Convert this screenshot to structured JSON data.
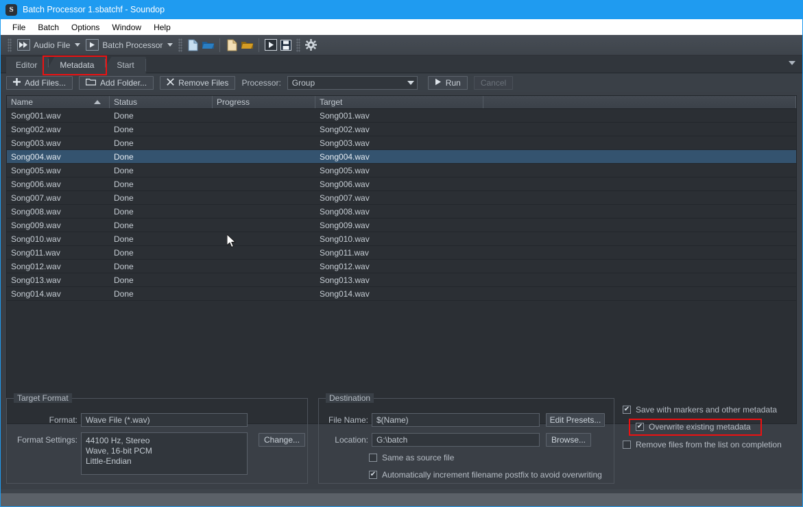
{
  "window": {
    "app_icon": "soundop-s-icon",
    "title": "Batch Processor 1.sbatchf - Soundop",
    "title_color": "#1f9bf0"
  },
  "menubar": {
    "items": [
      {
        "label": "File"
      },
      {
        "label": "Batch"
      },
      {
        "label": "Options"
      },
      {
        "label": "Window"
      },
      {
        "label": "Help"
      }
    ]
  },
  "toolbar": {
    "mode_combo": {
      "label": "Audio File",
      "icon": "fast-forward-icon"
    },
    "workspace_combo": {
      "label": "Batch Processor",
      "icon": "play-triangle-icon"
    },
    "icons": [
      {
        "name": "new-file-icon"
      },
      {
        "name": "open-file-icon"
      },
      {
        "name": "new-batch-icon"
      },
      {
        "name": "open-batch-icon"
      },
      {
        "name": "run-batch-icon"
      },
      {
        "name": "save-icon"
      },
      {
        "name": "settings-gear-icon"
      }
    ]
  },
  "tabs": {
    "items": [
      {
        "label": "Editor",
        "active": false
      },
      {
        "label": "Metadata",
        "active": true,
        "highlighted": true
      },
      {
        "label": "Start",
        "active": false
      }
    ],
    "overflow_icon": "chevron-down-icon"
  },
  "actionbar": {
    "add_files": {
      "label": "Add Files...",
      "icon": "plus-icon"
    },
    "add_folder": {
      "label": "Add Folder...",
      "icon": "folder-icon"
    },
    "remove_files": {
      "label": "Remove Files",
      "icon": "x-icon"
    },
    "processor_label": "Processor:",
    "processor_value": "Group",
    "run": {
      "label": "Run",
      "icon": "play-triangle-icon"
    },
    "cancel": {
      "label": "Cancel",
      "disabled": true
    }
  },
  "file_list": {
    "columns": [
      {
        "label": "Name",
        "sort": "asc"
      },
      {
        "label": "Status"
      },
      {
        "label": "Progress"
      },
      {
        "label": "Target"
      },
      {
        "label": ""
      }
    ],
    "selected_index": 3,
    "rows": [
      {
        "name": "Song001.wav",
        "status": "Done",
        "progress": "",
        "target": "Song001.wav"
      },
      {
        "name": "Song002.wav",
        "status": "Done",
        "progress": "",
        "target": "Song002.wav"
      },
      {
        "name": "Song003.wav",
        "status": "Done",
        "progress": "",
        "target": "Song003.wav"
      },
      {
        "name": "Song004.wav",
        "status": "Done",
        "progress": "",
        "target": "Song004.wav"
      },
      {
        "name": "Song005.wav",
        "status": "Done",
        "progress": "",
        "target": "Song005.wav"
      },
      {
        "name": "Song006.wav",
        "status": "Done",
        "progress": "",
        "target": "Song006.wav"
      },
      {
        "name": "Song007.wav",
        "status": "Done",
        "progress": "",
        "target": "Song007.wav"
      },
      {
        "name": "Song008.wav",
        "status": "Done",
        "progress": "",
        "target": "Song008.wav"
      },
      {
        "name": "Song009.wav",
        "status": "Done",
        "progress": "",
        "target": "Song009.wav"
      },
      {
        "name": "Song010.wav",
        "status": "Done",
        "progress": "",
        "target": "Song010.wav"
      },
      {
        "name": "Song011.wav",
        "status": "Done",
        "progress": "",
        "target": "Song011.wav"
      },
      {
        "name": "Song012.wav",
        "status": "Done",
        "progress": "",
        "target": "Song012.wav"
      },
      {
        "name": "Song013.wav",
        "status": "Done",
        "progress": "",
        "target": "Song013.wav"
      },
      {
        "name": "Song014.wav",
        "status": "Done",
        "progress": "",
        "target": "Song014.wav"
      }
    ]
  },
  "target_format": {
    "title": "Target Format",
    "format_label": "Format:",
    "format_value": "Wave File (*.wav)",
    "settings_label": "Format Settings:",
    "settings_value": "44100 Hz, Stereo\nWave, 16-bit PCM\nLittle-Endian",
    "change_button": "Change..."
  },
  "destination": {
    "title": "Destination",
    "filename_label": "File Name:",
    "filename_value": "$(Name)",
    "edit_presets_button": "Edit Presets...",
    "location_label": "Location:",
    "location_value": "G:\\batch",
    "browse_button": "Browse...",
    "same_as_source": {
      "label": "Same as source file",
      "checked": false
    },
    "auto_increment": {
      "label": "Automatically increment filename postfix to avoid overwriting",
      "checked": true
    }
  },
  "options": {
    "save_with_markers": {
      "label": "Save with markers and other metadata",
      "checked": true
    },
    "overwrite_metadata": {
      "label": "Overwrite existing metadata",
      "checked": true,
      "highlighted": true
    },
    "remove_on_completion": {
      "label": "Remove files from the list on completion",
      "checked": false
    }
  },
  "highlight_color": "#ee1111"
}
